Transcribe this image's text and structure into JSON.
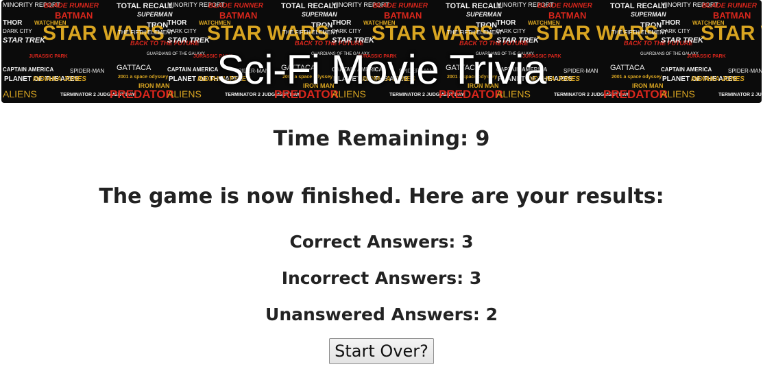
{
  "banner": {
    "title": "Sci-Fi Movie Trivia",
    "collage_logos": [
      "MINORITY REPORT",
      "BLADE RUNNER",
      "TOTAL RECALL",
      "SUPERMAN",
      "BATMAN",
      "THOR",
      "WATCHMEN",
      "TRON",
      "DARK CITY",
      "STAR WARS",
      "THE FIFTH ELEMENT",
      "STAR TREK",
      "BACK TO THE FUTURE",
      "CAPTAIN AMERICA",
      "GUARDIANS OF THE GALAXY",
      "GATTACA",
      "PLANET OF THE APES",
      "INDIANA JONES",
      "SPIDER-MAN",
      "2001 a space odyssey",
      "IRON MAN",
      "ALIENS",
      "TERMINATOR 2 JUDGMENT DAY",
      "PREDATOR",
      "AVENGERS",
      "JURASSIC PARK"
    ]
  },
  "game": {
    "time_remaining": "Time Remaining: 9",
    "finished_message": "The game is now finished. Here are your results:",
    "correct": "Correct Answers: 3",
    "incorrect": "Incorrect Answers: 3",
    "unanswered": "Unanswered Answers: 2",
    "start_over_label": "Start Over?"
  },
  "colors": {
    "text": "#222222",
    "banner_bg": "#0b0b0b",
    "logo_gold": "#d9a521",
    "logo_red": "#d8261c",
    "logo_white": "#f2f2f2"
  }
}
